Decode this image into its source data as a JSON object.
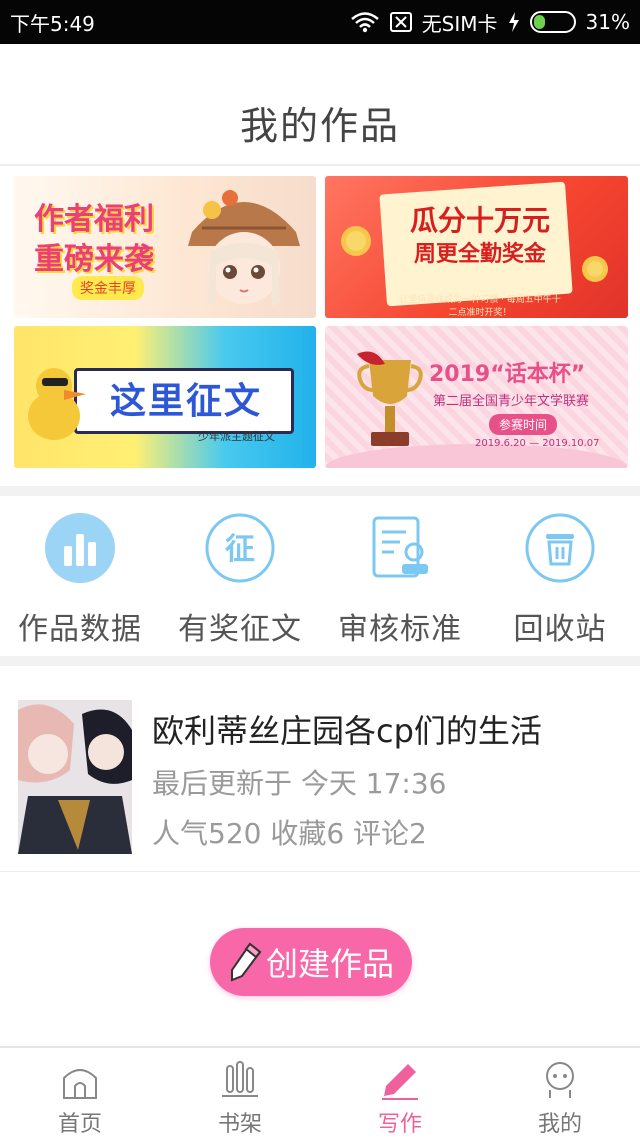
{
  "status_bar": {
    "time": "下午5:49",
    "sim": "无SIM卡",
    "battery": "31%",
    "battery_level": 0.31
  },
  "header": {
    "title": "我的作品"
  },
  "banners": [
    {
      "text_line1": "作者福利",
      "text_line2": "重磅来袭",
      "badge": "奖金丰厚"
    },
    {
      "text_line1": "瓜分十万元",
      "text_line2": "周更全勤奖金",
      "sub": "让坚持写作成为一种习惯 · 每周五中午十二点准时开奖！"
    },
    {
      "text": "这里征文",
      "sub": "少年派主题征文"
    },
    {
      "title": "2019“话本杯”",
      "sub": "第二届全国青少年文学联赛",
      "button": "参赛时间",
      "date": "2019.6.20 — 2019.10.07"
    }
  ],
  "actions": [
    {
      "label": "作品数据",
      "icon": "bar-chart-icon"
    },
    {
      "label": "有奖征文",
      "icon": "contest-icon"
    },
    {
      "label": "审核标准",
      "icon": "review-standard-icon"
    },
    {
      "label": "回收站",
      "icon": "trash-icon"
    }
  ],
  "work": {
    "title": "欧利蒂丝庄园各cp们的生活",
    "updated": "最后更新于 今天 17:36",
    "stats": "人气520 收藏6 评论2"
  },
  "create_button": {
    "label": "创建作品"
  },
  "bottom_nav": [
    {
      "label": "首页",
      "icon": "home-icon",
      "active": false
    },
    {
      "label": "书架",
      "icon": "bookshelf-icon",
      "active": false
    },
    {
      "label": "写作",
      "icon": "pencil-icon",
      "active": true
    },
    {
      "label": "我的",
      "icon": "profile-icon",
      "active": false
    }
  ],
  "colors": {
    "accent": "#f0609c",
    "action_icon": "#7cc8f2",
    "muted_text": "#9a9a9a"
  }
}
